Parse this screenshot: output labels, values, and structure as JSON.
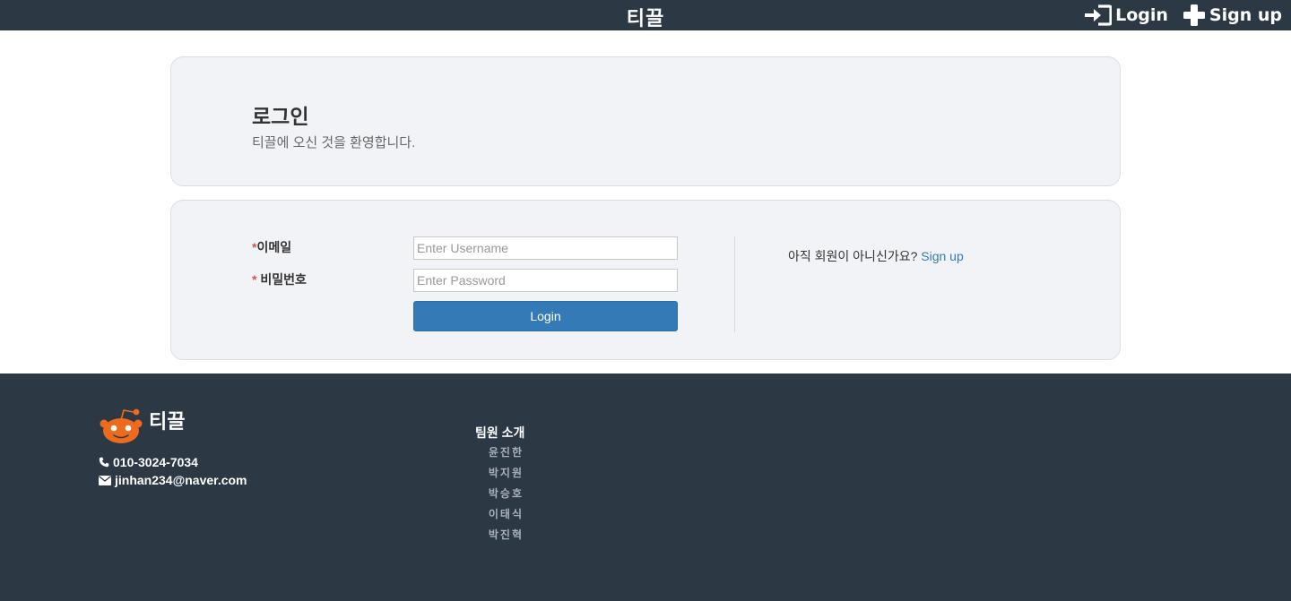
{
  "navbar": {
    "brand": "티끌",
    "login_label": "Login",
    "signup_label": "Sign up"
  },
  "header_panel": {
    "title": "로그인",
    "subtitle": "티끌에 오신 것을 환영합니다."
  },
  "login_form": {
    "email_required": "*",
    "email_label": "이메일",
    "password_required": "* ",
    "password_label": "비밀번호",
    "email_placeholder": "Enter Username",
    "password_placeholder": "Enter Password",
    "submit_label": "Login",
    "signup_prompt": "아직 회원이 아니신가요?",
    "signup_link": "Sign up"
  },
  "footer": {
    "logo_text": "티끌",
    "phone": "010-3024-7034",
    "email": "jinhan234@naver.com",
    "team_title": "팀원 소개",
    "team_members": [
      "윤진한",
      "박지원",
      "박승호",
      "이태식",
      "박진혁"
    ]
  },
  "colors": {
    "navbar_bg": "#2d3845",
    "panel_bg": "#f2f3f7",
    "primary": "#337ab7",
    "required": "#d9534f",
    "logo_orange": "#ee6b1e"
  },
  "icons": {
    "login": "sign-in-icon",
    "signup": "plus-icon",
    "phone": "phone-icon",
    "mail": "envelope-icon",
    "logo": "alien-mascot-logo"
  }
}
